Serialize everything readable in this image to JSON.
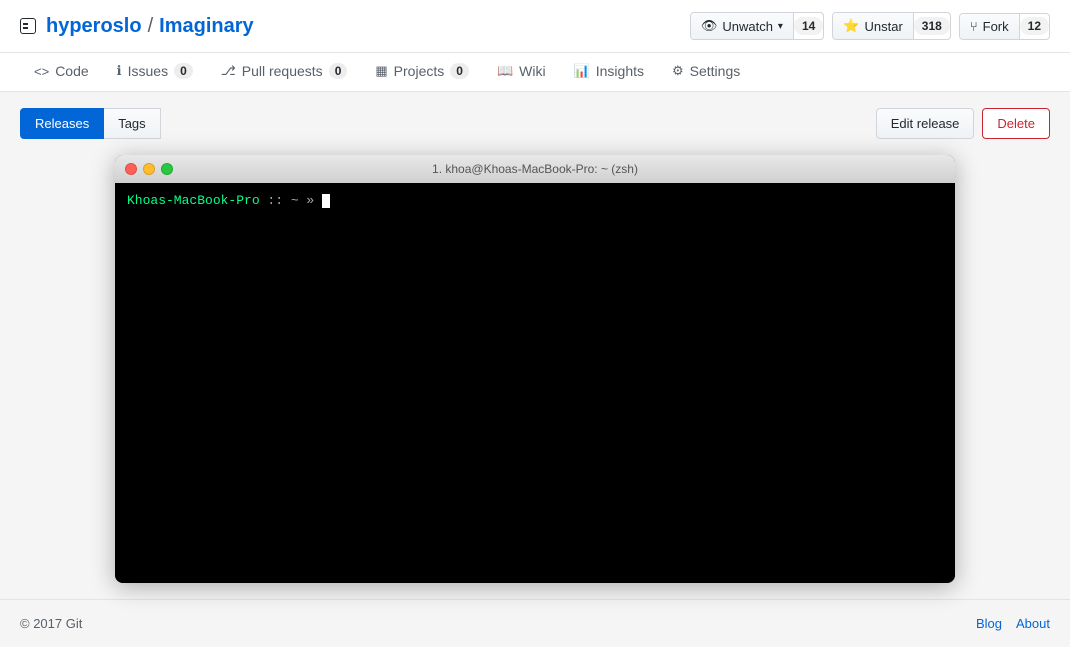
{
  "header": {
    "repo_icon": "repo-icon",
    "owner": "hyperoslo",
    "separator": "/",
    "repo": "Imaginary",
    "actions": {
      "watch": {
        "label": "Unwatch",
        "count": "14"
      },
      "star": {
        "label": "Unstar",
        "count": "318"
      },
      "fork": {
        "label": "Fork",
        "count": "12"
      }
    }
  },
  "nav": {
    "tabs": [
      {
        "id": "code",
        "label": "Code",
        "badge": null,
        "active": false
      },
      {
        "id": "issues",
        "label": "Issues",
        "badge": "0",
        "active": false
      },
      {
        "id": "pull-requests",
        "label": "Pull requests",
        "badge": "0",
        "active": false
      },
      {
        "id": "projects",
        "label": "Projects",
        "badge": "0",
        "active": false
      },
      {
        "id": "wiki",
        "label": "Wiki",
        "badge": null,
        "active": false
      },
      {
        "id": "insights",
        "label": "Insights",
        "badge": null,
        "active": false
      },
      {
        "id": "settings",
        "label": "Settings",
        "badge": null,
        "active": false
      }
    ]
  },
  "content": {
    "sub_tabs": [
      {
        "label": "Releases",
        "active": true
      },
      {
        "label": "Tags",
        "active": false
      }
    ],
    "edit_label": "Edit release",
    "delete_label": "Delete"
  },
  "terminal": {
    "title": "1. khoa@Khoas-MacBook-Pro: ~ (zsh)",
    "host": "Khoas-MacBook-Pro",
    "separator": " :: ~ »",
    "cursor": ""
  },
  "footer": {
    "copyright": "© 2017 Git",
    "links": [
      {
        "label": "Blog"
      },
      {
        "label": "About"
      }
    ]
  }
}
